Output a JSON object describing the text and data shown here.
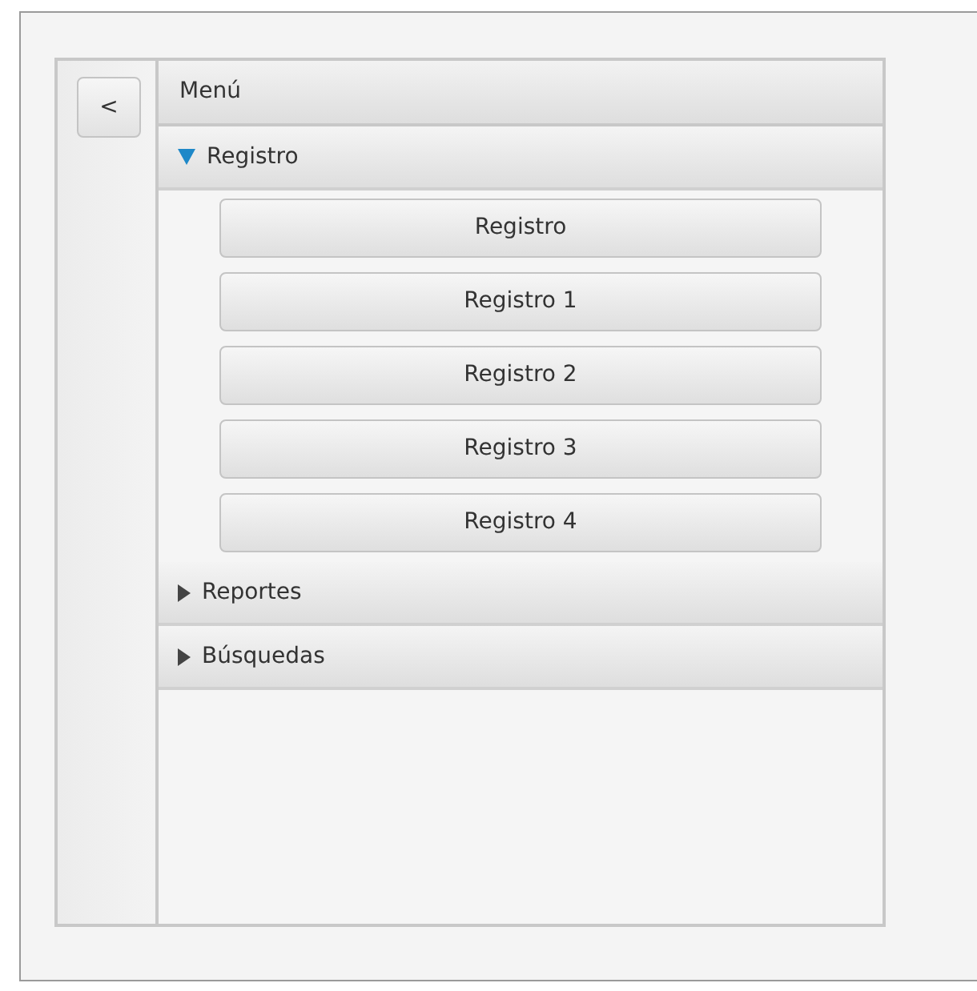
{
  "collapse_button": "<",
  "menu_title": "Menú",
  "sections": [
    {
      "label": "Registro",
      "expanded": true,
      "buttons": [
        "Registro",
        "Registro 1",
        "Registro 2",
        "Registro 3",
        "Registro 4"
      ]
    },
    {
      "label": "Reportes",
      "expanded": false
    },
    {
      "label": "Búsquedas",
      "expanded": false
    }
  ]
}
